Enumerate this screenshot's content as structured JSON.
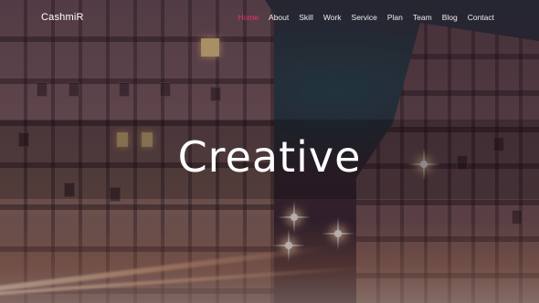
{
  "navbar": {
    "brand": "CashmiR",
    "links": [
      {
        "label": "Home",
        "active": true
      },
      {
        "label": "About",
        "active": false
      },
      {
        "label": "Skill",
        "active": false
      },
      {
        "label": "Work",
        "active": false
      },
      {
        "label": "Service",
        "active": false
      },
      {
        "label": "Plan",
        "active": false
      },
      {
        "label": "Team",
        "active": false
      },
      {
        "label": "Blog",
        "active": false
      },
      {
        "label": "Contact",
        "active": false
      }
    ],
    "active_color": "#e8336b"
  },
  "hero": {
    "title": "Creative"
  }
}
